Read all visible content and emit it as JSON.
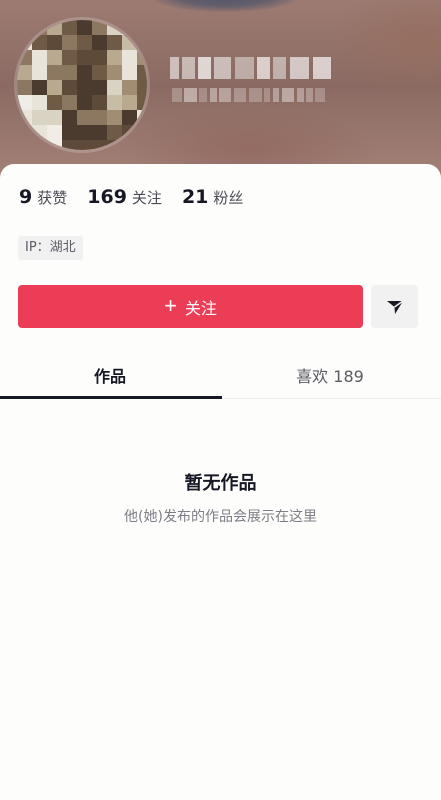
{
  "profile": {
    "avatar_icon": "avatar-image-pixelated",
    "nickname_redacted": true
  },
  "stats": [
    {
      "value": "9",
      "label": "获赞"
    },
    {
      "value": "169",
      "label": "关注"
    },
    {
      "value": "21",
      "label": "粉丝"
    }
  ],
  "ip_tag": "IP：湖北",
  "actions": {
    "follow_icon": "plus-icon",
    "follow_label": "关注",
    "share_icon": "send-arrow-icon"
  },
  "tabs": [
    {
      "label": "作品",
      "active": true
    },
    {
      "label": "喜欢 189",
      "active": false
    }
  ],
  "empty_state": {
    "title": "暂无作品",
    "subtitle": "他(她)发布的作品会展示在这里"
  },
  "colors": {
    "accent": "#ec3d56",
    "text": "#161823",
    "secondary": "#7d7e85"
  }
}
